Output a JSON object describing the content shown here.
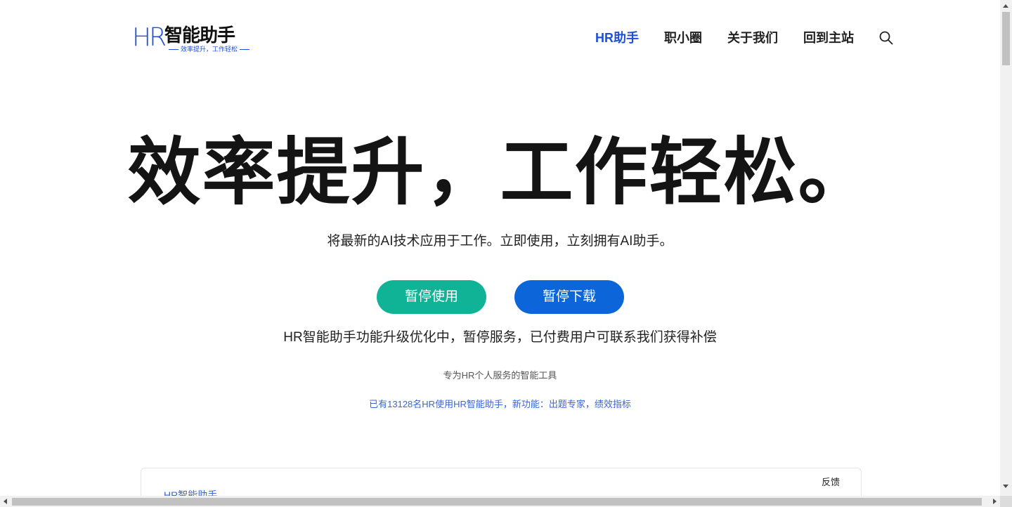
{
  "header": {
    "logo_letters": "HR",
    "logo_name": "智能助手",
    "logo_slogan": "效率提升，工作轻松",
    "nav": [
      {
        "label": "HR助手",
        "active": true
      },
      {
        "label": "职小圈",
        "active": false
      },
      {
        "label": "关于我们",
        "active": false
      },
      {
        "label": "回到主站",
        "active": false
      }
    ],
    "search_icon": "search-icon"
  },
  "hero": {
    "title": "效率提升，工作轻松。",
    "subtitle": "将最新的AI技术应用于工作。立即使用，立刻拥有AI助手。",
    "btn_use": "暂停使用",
    "btn_download": "暂停下载",
    "notice": "HR智能助手功能升级优化中，暂停服务，已付费用户可联系我们获得补偿",
    "tagline": "专为HR个人服务的智能工具",
    "users_link": "已有13128名HR使用HR智能助手，新功能：出题专家，绩效指标"
  },
  "card": {
    "title": "HR智能助手",
    "feedback": "反馈"
  },
  "colors": {
    "brand_blue": "#1f4fd8",
    "btn_use": "#10b395",
    "btn_download": "#0d66d9"
  }
}
